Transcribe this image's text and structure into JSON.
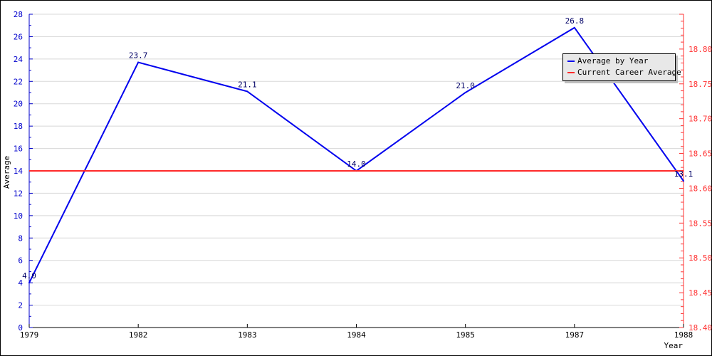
{
  "chart_data": {
    "type": "line",
    "title": "",
    "xlabel": "Year",
    "ylabel": "Average",
    "y2label": "",
    "categories": [
      "1979",
      "1982",
      "1983",
      "1984",
      "1985",
      "1987",
      "1988"
    ],
    "series": [
      {
        "name": "Average by Year",
        "axis": "left",
        "color": "#0000ee",
        "values": [
          4.0,
          23.7,
          21.1,
          14.0,
          21.0,
          26.8,
          13.1
        ],
        "labels": [
          "4.0",
          "23.7",
          "21.1",
          "14.0",
          "21.0",
          "26.8",
          "13.1"
        ]
      },
      {
        "name": "Current Career Average",
        "axis": "right",
        "color": "#ff2a2a",
        "values": [
          18.625,
          18.625,
          18.625,
          18.625,
          18.625,
          18.625,
          18.625
        ]
      }
    ],
    "ylim": [
      0,
      28
    ],
    "yticks": [
      "0",
      "2",
      "4",
      "6",
      "8",
      "10",
      "12",
      "14",
      "16",
      "18",
      "20",
      "22",
      "24",
      "26",
      "28"
    ],
    "y2lim": [
      18.4,
      18.85
    ],
    "y2ticks": [
      "18.40",
      "18.45",
      "18.50",
      "18.55",
      "18.60",
      "18.65",
      "18.70",
      "18.75",
      "18.80"
    ],
    "grid": true,
    "legend_position": "top-right",
    "left_axis_color": "#0000cc",
    "right_axis_color": "#ff3333"
  }
}
